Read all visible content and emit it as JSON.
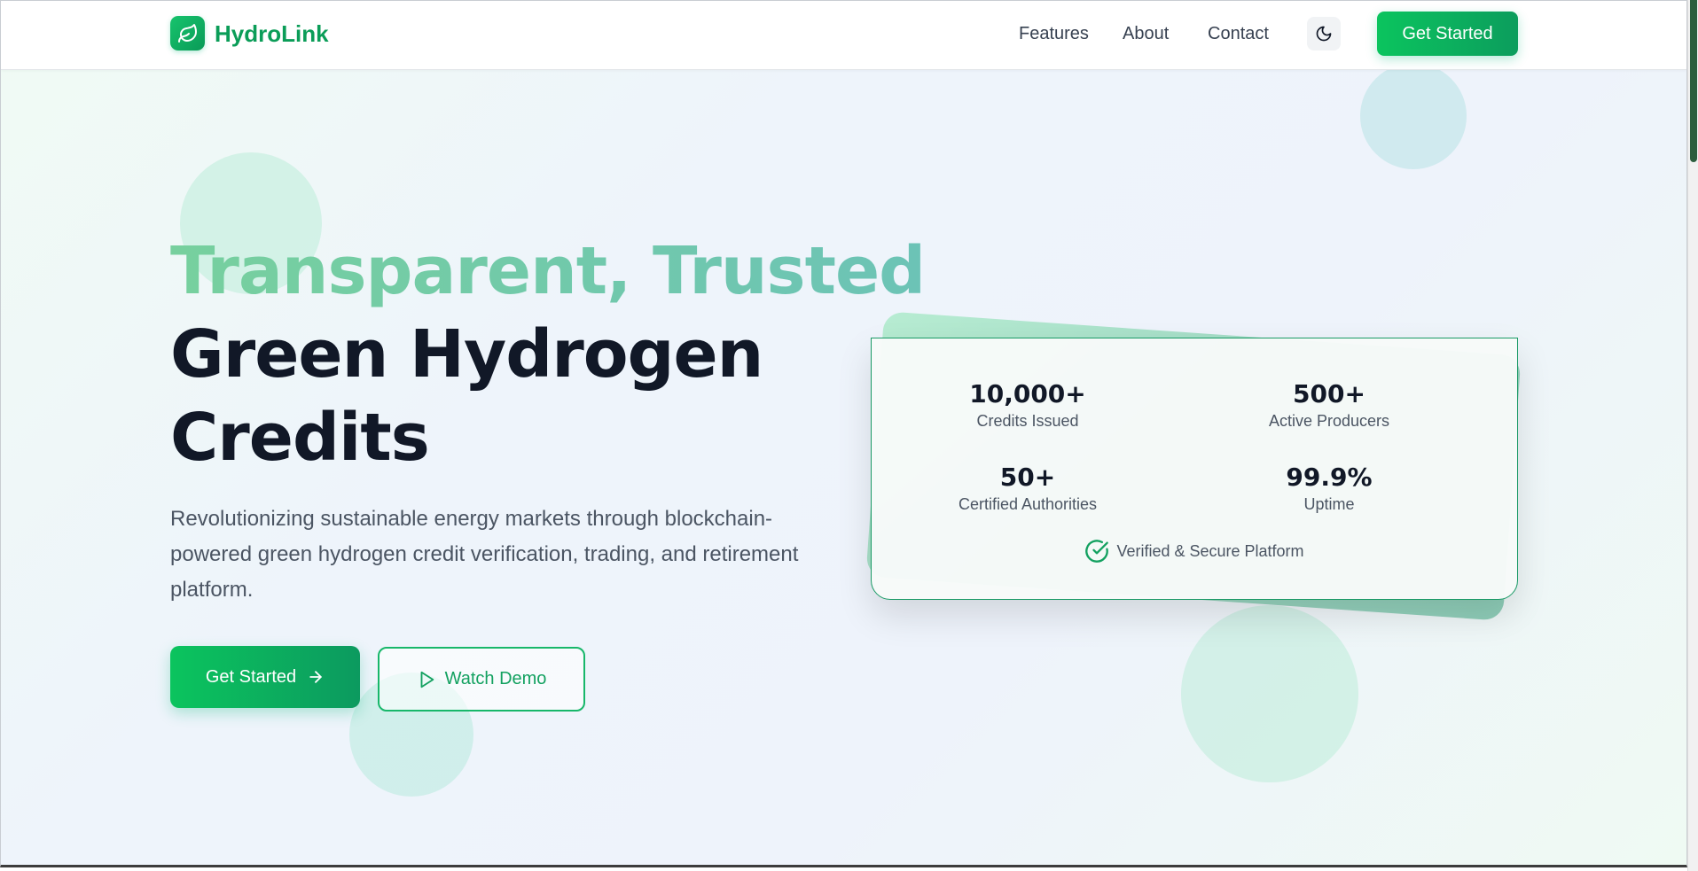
{
  "header": {
    "brand": "HydroLink",
    "nav": [
      {
        "label": "Features"
      },
      {
        "label": "About"
      },
      {
        "label": "Contact"
      }
    ],
    "theme_toggle_icon": "moon-icon",
    "cta_label": "Get Started"
  },
  "hero": {
    "headline_accent": "Transparent, Trusted",
    "headline_line2": "Green Hydrogen",
    "headline_line3": "Credits",
    "subtext": "Revolutionizing sustainable energy markets through blockchain-powered green hydrogen credit verification, trading, and retirement platform.",
    "primary_button": "Get Started",
    "primary_button_icon": "arrow-right-icon",
    "secondary_button": "Watch Demo",
    "secondary_button_icon": "play-icon"
  },
  "stats": {
    "items": [
      {
        "value": "10,000+",
        "label": "Credits Issued"
      },
      {
        "value": "500+",
        "label": "Active Producers"
      },
      {
        "value": "50+",
        "label": "Certified Authorities"
      },
      {
        "value": "99.9%",
        "label": "Uptime"
      }
    ],
    "verified_text": "Verified & Secure Platform",
    "verified_icon": "check-circle-icon"
  },
  "colors": {
    "brand_green": "#0b9d58",
    "accent_gradient_start": "#77d09e",
    "accent_gradient_end": "#6cc3b6",
    "text_dark": "#111827",
    "text_muted": "#4b5563"
  }
}
